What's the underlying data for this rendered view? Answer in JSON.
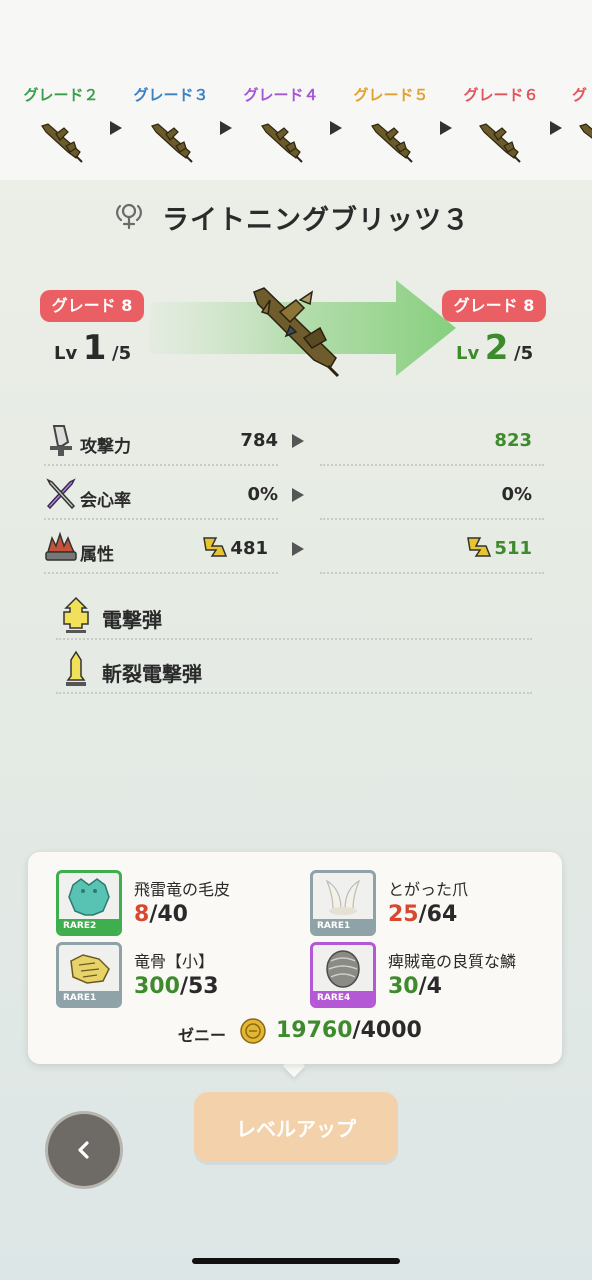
{
  "grades": [
    {
      "label": "グレード２",
      "color": "#3a9e4a"
    },
    {
      "label": "グレード３",
      "color": "#3b7fc4"
    },
    {
      "label": "グレード４",
      "color": "#a456d6"
    },
    {
      "label": "グレード５",
      "color": "#e3a02e"
    },
    {
      "label": "グレード６",
      "color": "#e2555c"
    },
    {
      "label": "グ",
      "color": "#e2555c"
    }
  ],
  "weapon": {
    "name": "ライトニングブリッツ３",
    "icon": "lightbowgun-icon"
  },
  "upgrade": {
    "current": {
      "grade": "グレード 8",
      "lv_prefix": "Lv",
      "lv": "1",
      "lv_max": "/5"
    },
    "next": {
      "grade": "グレード 8",
      "lv_prefix": "Lv",
      "lv": "2",
      "lv_max": "/5"
    }
  },
  "stats": [
    {
      "name": "攻撃力",
      "icon": "sword-icon",
      "old": "784",
      "new": "823"
    },
    {
      "name": "会心率",
      "icon": "crossed-swords-icon",
      "old": "0%",
      "new": "0%"
    },
    {
      "name": "属性",
      "icon": "element-icon",
      "old": "481",
      "new": "511",
      "element_icon": "thunder-element-icon"
    }
  ],
  "ammo": [
    {
      "name": "電撃弾",
      "icon": "thunder-ammo-icon"
    },
    {
      "name": "斬裂電撃弾",
      "icon": "slicing-ammo-icon"
    }
  ],
  "materials": [
    {
      "name": "飛雷竜の毛皮",
      "have": "8",
      "need": "/40",
      "rarity": "RARE2",
      "rarity_color": "#3fae4e",
      "status": "bad"
    },
    {
      "name": "とがった爪",
      "have": "25",
      "need": "/64",
      "rarity": "RARE1",
      "rarity_color": "#8ea2a7",
      "status": "bad"
    },
    {
      "name": "竜骨【小】",
      "have": "300",
      "need": "/53",
      "rarity": "RARE1",
      "rarity_color": "#8ea2a7",
      "status": "ok"
    },
    {
      "name": "痺賊竜の良質な鱗",
      "have": "30",
      "need": "/4",
      "rarity": "RARE4",
      "rarity_color": "#b558d6",
      "status": "ok"
    }
  ],
  "zeny": {
    "label": "ゼニー",
    "have": "19760",
    "need": "/4000"
  },
  "buttons": {
    "level_up": "レベルアップ"
  }
}
